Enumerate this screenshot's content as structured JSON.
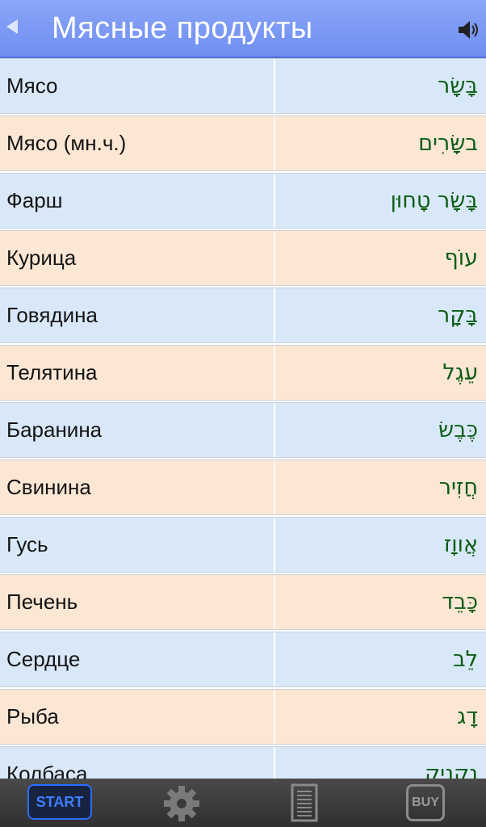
{
  "header": {
    "title": "Мясные продукты",
    "back_icon": "back-arrow-icon",
    "sound_icon": "speaker-icon"
  },
  "rows": [
    {
      "ru": "Мясо",
      "he": "בָּשָׂר",
      "bg": "blue"
    },
    {
      "ru": "Мясо (мн.ч.)",
      "he": "בשָּׂרִים",
      "bg": "peach"
    },
    {
      "ru": "Фарш",
      "he": "בָּשָׂר טָחוּן",
      "bg": "blue"
    },
    {
      "ru": "Курица",
      "he": "עוֹף",
      "bg": "peach"
    },
    {
      "ru": "Говядина",
      "he": "בָּקָר",
      "bg": "blue"
    },
    {
      "ru": "Телятина",
      "he": "עֵגֶל",
      "bg": "peach"
    },
    {
      "ru": "Баранина",
      "he": "כֶּבֶשׂ",
      "bg": "blue"
    },
    {
      "ru": "Свинина",
      "he": "חֲזִיר",
      "bg": "peach"
    },
    {
      "ru": "Гусь",
      "he": "אֲווָז",
      "bg": "blue"
    },
    {
      "ru": "Печень",
      "he": "כָּבֵד",
      "bg": "peach"
    },
    {
      "ru": "Сердце",
      "he": "לֵב",
      "bg": "blue"
    },
    {
      "ru": "Рыба",
      "he": "דָג",
      "bg": "peach"
    },
    {
      "ru": "Колбаса",
      "he": "נַקנִיק",
      "bg": "blue"
    }
  ],
  "tabbar": {
    "start_label": "START",
    "settings_icon": "gear-icon",
    "document_icon": "document-icon",
    "buy_label": "BUY"
  },
  "colors": {
    "header_blue": "#7b98f5",
    "row_blue": "#d9e8f9",
    "row_peach": "#fce6d4",
    "hebrew_text": "#0c5d15",
    "start_blue": "#3f7dff"
  }
}
